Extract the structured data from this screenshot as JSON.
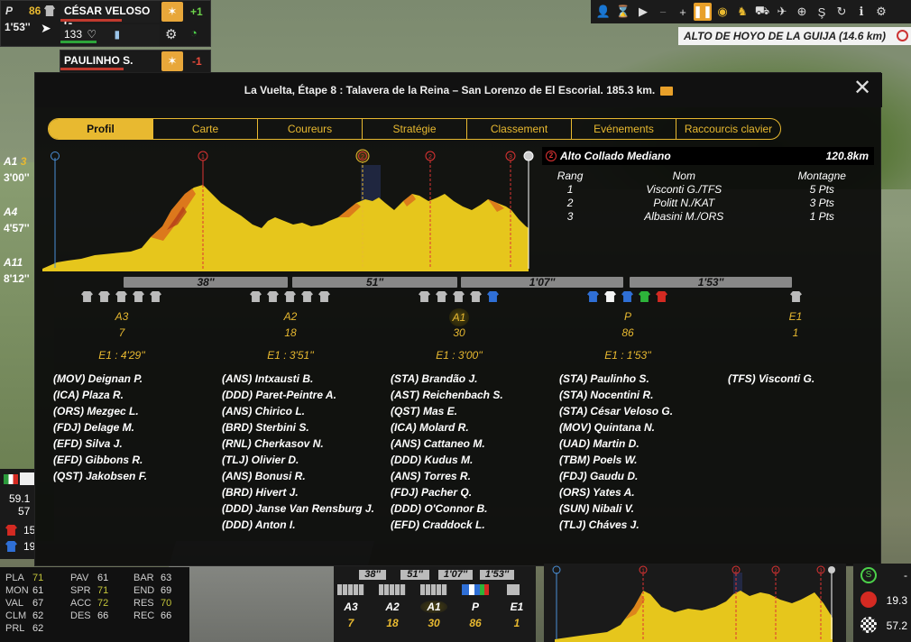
{
  "rider_card_1": {
    "pos_letter": "P",
    "pos_num": "86",
    "gap": "1'53''",
    "name": "CÉSAR VELOSO G.",
    "number": "133",
    "modifier": "+1"
  },
  "rider_card_2": {
    "name": "PAULINHO S.",
    "modifier": "-1"
  },
  "toolbar": {
    "climb_name": "ALTO DE HOYO DE LA GUIJA (14.6 km)"
  },
  "side_groups": [
    {
      "label": "A1",
      "extra": "3",
      "time": "3'00''"
    },
    {
      "label": "A4",
      "time": "4'57''"
    },
    {
      "label": "A11",
      "time": "8'12''"
    }
  ],
  "dialog": {
    "title": "La Vuelta, Étape 8 : Talavera de la Reina – San Lorenzo de El Escorial. 185.3 km.",
    "close": "✕",
    "tabs": [
      "Profil",
      "Carte",
      "Coureurs",
      "Stratégie",
      "Classement",
      "Evénements",
      "Raccourcis clavier"
    ],
    "active_tab": "Profil"
  },
  "climb": {
    "number": "2",
    "name": "Alto Collado Mediano",
    "km": "120.8km",
    "headers": [
      "Rang",
      "Nom",
      "Montagne"
    ],
    "rows": [
      [
        "1",
        "Visconti G./TFS",
        "5 Pts"
      ],
      [
        "2",
        "Politt N./KAT",
        "3 Pts"
      ],
      [
        "3",
        "Albasini M./ORS",
        "1 Pts"
      ]
    ]
  },
  "profile_markers": [
    "1",
    "2",
    "2",
    "3"
  ],
  "gap_bars": [
    "38''",
    "51''",
    "1'07''",
    "1'53''"
  ],
  "groups": [
    {
      "label": "A3",
      "count": "7",
      "gap": "E1 : 4'29''"
    },
    {
      "label": "A2",
      "count": "18",
      "gap": "E1 : 3'51''"
    },
    {
      "label": "A1",
      "count": "30",
      "gap": "E1 : 3'00''"
    },
    {
      "label": "P",
      "count": "86",
      "gap": "E1 : 1'53''"
    },
    {
      "label": "E1",
      "count": "1"
    }
  ],
  "rider_lists": [
    [
      "(MOV) Deignan P.",
      "(ICA) Plaza R.",
      "(ORS) Mezgec L.",
      "(FDJ) Delage M.",
      "(EFD) Silva J.",
      "(EFD) Gibbons R.",
      "(QST) Jakobsen F."
    ],
    [
      "(ANS) Intxausti B.",
      "(DDD) Paret-Peintre A.",
      "(ANS) Chirico L.",
      "(BRD) Sterbini S.",
      "(RNL) Cherkasov N.",
      "(TLJ) Olivier D.",
      "(ANS) Bonusi R.",
      "(BRD) Hivert J.",
      "(DDD) Janse Van Rensburg J.",
      "(DDD) Anton I."
    ],
    [
      "(STA) Brandão J.",
      "(AST) Reichenbach S.",
      "(QST) Mas E.",
      "(ICA) Molard R.",
      "(ANS) Cattaneo M.",
      "(DDD) Kudus M.",
      "(ANS) Torres R.",
      "(FDJ) Pacher Q.",
      "(DDD) O'Connor B.",
      "(EFD) Craddock L."
    ],
    [
      "(STA) Paulinho S.",
      "(STA) Nocentini R.",
      "(STA) César Veloso G.",
      "(MOV) Quintana N.",
      "(UAD) Martin D.",
      "(TBM) Poels W.",
      "(FDJ) Gaudu D.",
      "(ORS) Yates A.",
      "(SUN) Nibali V.",
      "(TLJ) Cháves J."
    ],
    [
      "(TFS) Visconti G."
    ]
  ],
  "left_mini": {
    "top": "59.1",
    "bottom": "57"
  },
  "left_mini_jerseys": [
    "15",
    "19"
  ],
  "stats": {
    "col1": [
      [
        "PLA",
        "71"
      ],
      [
        "MON",
        "61"
      ],
      [
        "VAL",
        "67"
      ],
      [
        "CLM",
        "62"
      ],
      [
        "PRL",
        "62"
      ]
    ],
    "col2": [
      [
        "PAV",
        "61"
      ],
      [
        "SPR",
        "71"
      ],
      [
        "ACC",
        "72"
      ],
      [
        "DES",
        "66"
      ]
    ],
    "col3": [
      [
        "BAR",
        "63"
      ],
      [
        "END",
        "69"
      ],
      [
        "RES",
        "70"
      ],
      [
        "REC",
        "66"
      ]
    ]
  },
  "mini_groups": {
    "gaps": [
      "38''",
      "51''",
      "1'07''",
      "1'53''"
    ],
    "labels": [
      "A3",
      "A2",
      "A1",
      "P",
      "E1"
    ],
    "counts": [
      "7",
      "18",
      "30",
      "86",
      "1"
    ]
  },
  "right_stats": {
    "top": "-",
    "mid": "19.3",
    "bottom": "57.2"
  },
  "colors": {
    "accent": "#e8b930",
    "profile_fill": "#e6c61c",
    "marker_red": "#d33"
  }
}
